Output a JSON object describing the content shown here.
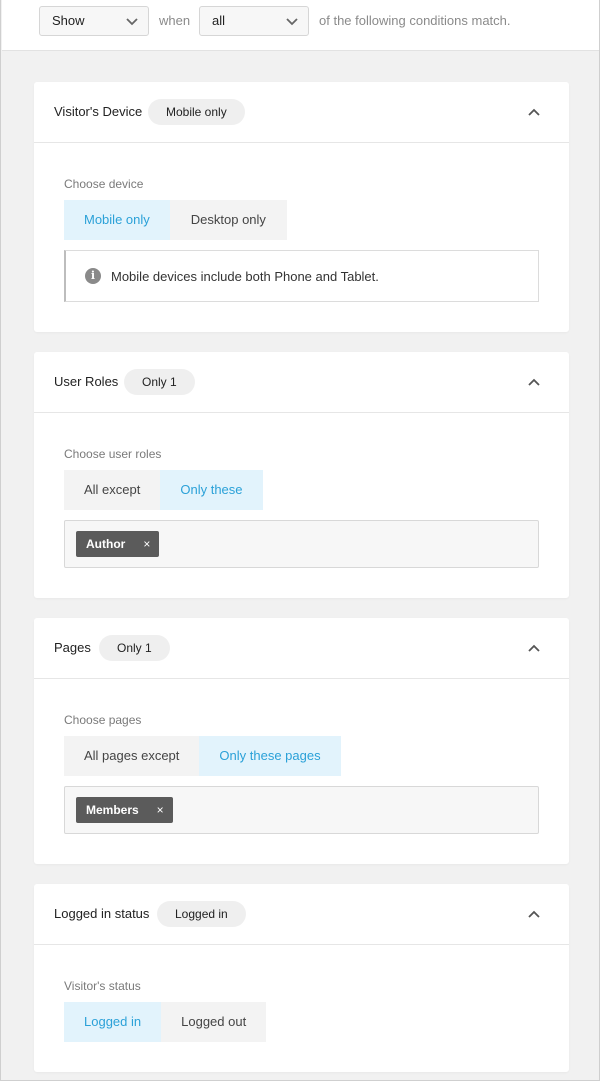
{
  "header": {
    "action_select": "Show",
    "when_label": "when",
    "match_select": "all",
    "suffix": "of the following conditions match."
  },
  "sections": [
    {
      "title": "Visitor's Device",
      "badge": "Mobile only",
      "field_label": "Choose device",
      "options": [
        "Mobile only",
        "Desktop only"
      ],
      "active_option": "Mobile only",
      "notice": "Mobile devices include both Phone and Tablet."
    },
    {
      "title": "User Roles",
      "badge": "Only 1",
      "field_label": "Choose user roles",
      "options": [
        "All except",
        "Only these"
      ],
      "active_option": "Only these",
      "tags": [
        "Author"
      ]
    },
    {
      "title": "Pages",
      "badge": "Only 1",
      "field_label": "Choose pages",
      "options": [
        "All pages except",
        "Only these pages"
      ],
      "active_option": "Only these pages",
      "tags": [
        "Members"
      ]
    },
    {
      "title": "Logged in status",
      "badge": "Logged in",
      "field_label": "Visitor's status",
      "options": [
        "Logged in",
        "Logged out"
      ],
      "active_option": "Logged in"
    }
  ],
  "icons": {
    "select_arrow": "chevron-down-icon",
    "collapse": "chevron-up-icon",
    "info": "info-icon",
    "remove_tag": "close-icon"
  },
  "colors": {
    "active_bg": "#e2f3fc",
    "active_text": "#2ba1d8",
    "tag_bg": "#5b5b5b"
  }
}
